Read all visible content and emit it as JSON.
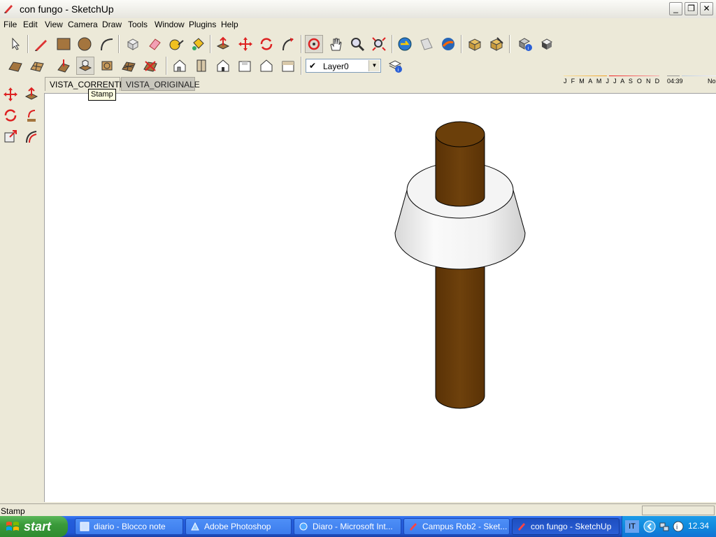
{
  "window": {
    "title": "con fungo - SketchUp"
  },
  "menu": [
    "File",
    "Edit",
    "View",
    "Camera",
    "Draw",
    "Tools",
    "Window",
    "Plugins",
    "Help"
  ],
  "layer": {
    "current": "Layer0"
  },
  "shadows": {
    "months": "J F M A M J J A S O N D",
    "time": "04:39",
    "sun_label": "No"
  },
  "scene_tabs": [
    "VISTA_CORRENTE",
    "VISTA_ORIGINALE"
  ],
  "tooltip": "Stamp",
  "status": {
    "text": "Stamp"
  },
  "taskbar": {
    "start_label": "start",
    "tasks": [
      "diario - Blocco note",
      "Adobe Photoshop",
      "Diaro - Microsoft Int...",
      "Campus Rob2 - Sket...",
      "con fungo - SketchUp"
    ],
    "language": "IT",
    "clock": "12.34"
  },
  "colors": {
    "wood": "#6b3f0a",
    "viewport_bg": "#ffffff",
    "taskbar": "#245edb"
  }
}
